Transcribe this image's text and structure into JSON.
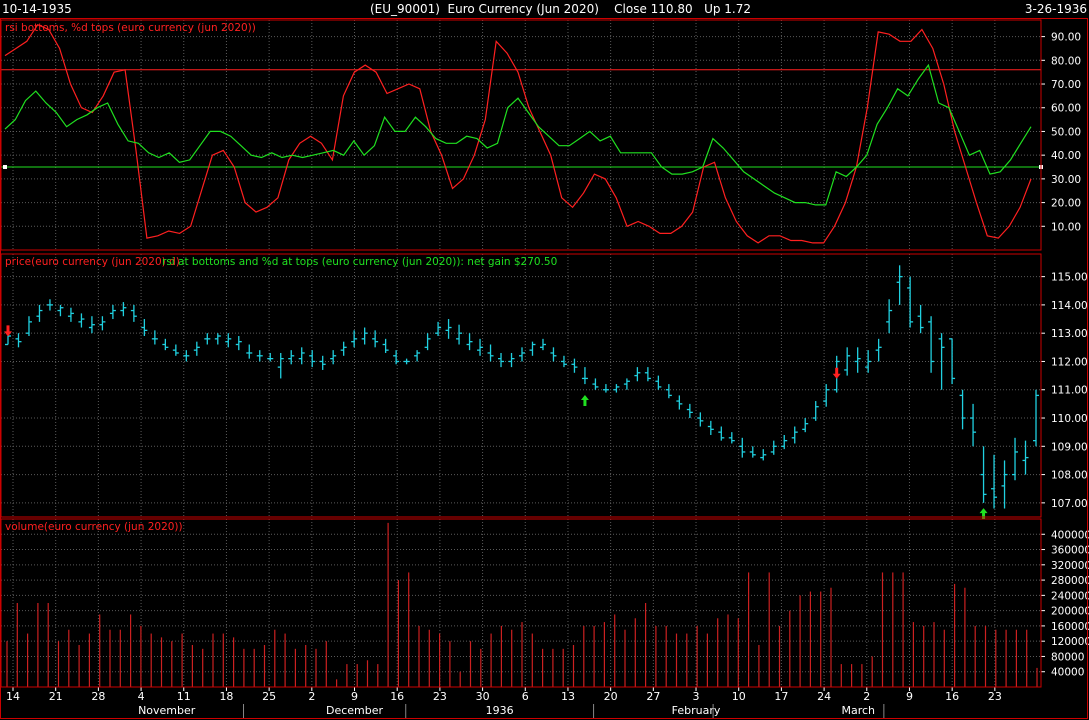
{
  "header": {
    "start_date": "10-14-1935",
    "title": "(EU_90001)  Euro Currency (Jun 2020)    Close 110.80   Up 1.72",
    "end_date": "3-26-1936"
  },
  "colors": {
    "background": "#000000",
    "frame": "#cc0000",
    "grid": "#5a5a5a",
    "rsi": "#ff2020",
    "stoch_d": "#20e020",
    "price_bar": "#20d0e0",
    "volume_bar": "#cc2020",
    "axis_text": "#ffffff",
    "buy_arrow": "#20e020",
    "sell_arrow": "#ff2020",
    "panel_label_rsi": "#ff2020",
    "panel_label_price": "#ff2020",
    "panel_label_price_2": "#20e020",
    "panel_label_volume": "#ff2020"
  },
  "chart_data": [
    {
      "type": "line",
      "title": "rsi bottoms, %d tops (euro currency (jun 2020))",
      "ylim": [
        0,
        97
      ],
      "yticks": [
        10,
        20,
        30,
        40,
        50,
        60,
        70,
        80,
        90
      ],
      "ytick_labels": [
        "10.00",
        "20.00",
        "30.00",
        "40.00",
        "50.00",
        "60.00",
        "70.00",
        "80.00",
        "90.00"
      ],
      "reference_lines": [
        35,
        76
      ],
      "series": [
        {
          "color": "rsi",
          "values": [
            82,
            85,
            88,
            95,
            93,
            85,
            70,
            60,
            58,
            65,
            75,
            76,
            42,
            5,
            6,
            8,
            7,
            10,
            25,
            40,
            42,
            35,
            20,
            16,
            18,
            22,
            38,
            45,
            48,
            45,
            38,
            65,
            75,
            78,
            75,
            66,
            68,
            70,
            68,
            50,
            40,
            26,
            30,
            40,
            55,
            88,
            83,
            75,
            60,
            50,
            40,
            22,
            18,
            24,
            32,
            30,
            22,
            10,
            12,
            10,
            7,
            7,
            10,
            16,
            35,
            37,
            22,
            12,
            6,
            3,
            6,
            6,
            4,
            4,
            3,
            3,
            10,
            20,
            35,
            60,
            92,
            91,
            88,
            88,
            93,
            85,
            70,
            50,
            35,
            20,
            6,
            5,
            10,
            18,
            30
          ]
        },
        {
          "color": "stoch_d",
          "values": [
            51,
            55,
            63,
            67,
            62,
            58,
            52,
            55,
            57,
            60,
            62,
            53,
            46,
            45,
            41,
            39,
            41,
            37,
            38,
            44,
            50,
            50,
            48,
            44,
            40,
            39,
            41,
            39,
            40,
            39,
            40,
            41,
            42,
            40,
            46,
            40,
            44,
            56,
            50,
            50,
            56,
            52,
            47,
            45,
            45,
            48,
            47,
            43,
            45,
            60,
            64,
            58,
            52,
            48,
            44,
            44,
            47,
            50,
            46,
            48,
            41,
            41,
            41,
            41,
            35,
            32,
            32,
            33,
            35,
            47,
            43,
            38,
            33,
            30,
            27,
            24,
            22,
            20,
            20,
            19,
            19,
            33,
            31,
            35,
            40,
            53,
            60,
            68,
            65,
            72,
            78,
            62,
            60,
            50,
            40,
            42,
            32,
            33,
            38,
            45,
            52
          ]
        }
      ]
    },
    {
      "type": "bar",
      "subtype": "ohlc",
      "title": "price(euro currency (jun 2020) d)",
      "subtitle": "rsi at bottoms and %d at tops (euro currency (jun 2020)): net gain $270.50",
      "ylim": [
        106.5,
        115.8
      ],
      "yticks": [
        107,
        108,
        109,
        110,
        111,
        112,
        113,
        114,
        115
      ],
      "ytick_labels": [
        "107.00",
        "108.00",
        "109.00",
        "110.00",
        "111.00",
        "112.00",
        "113.00",
        "114.00",
        "115.00"
      ],
      "bars": [
        [
          12.6,
          13.2,
          12.6,
          12.9
        ],
        [
          12.8,
          13.0,
          12.5,
          12.7
        ],
        [
          13.0,
          13.6,
          12.9,
          13.4
        ],
        [
          13.6,
          14.0,
          13.4,
          13.8
        ],
        [
          14.0,
          14.2,
          13.8,
          14.0
        ],
        [
          13.8,
          14.0,
          13.6,
          13.9
        ],
        [
          13.6,
          13.9,
          13.4,
          13.7
        ],
        [
          13.4,
          13.7,
          13.2,
          13.5
        ],
        [
          13.2,
          13.6,
          13.0,
          13.3
        ],
        [
          13.3,
          13.6,
          13.1,
          13.4
        ],
        [
          13.7,
          14.0,
          13.5,
          13.8
        ],
        [
          13.8,
          14.1,
          13.6,
          13.9
        ],
        [
          13.8,
          14.0,
          13.4,
          13.6
        ],
        [
          13.2,
          13.5,
          12.9,
          13.1
        ],
        [
          12.8,
          13.1,
          12.6,
          12.8
        ],
        [
          12.6,
          12.8,
          12.4,
          12.5
        ],
        [
          12.4,
          12.6,
          12.2,
          12.3
        ],
        [
          12.2,
          12.4,
          12.0,
          12.2
        ],
        [
          12.4,
          12.7,
          12.2,
          12.5
        ],
        [
          12.8,
          13.0,
          12.6,
          12.8
        ],
        [
          12.8,
          13.0,
          12.6,
          12.9
        ],
        [
          12.7,
          13.0,
          12.5,
          12.8
        ],
        [
          12.6,
          12.9,
          12.4,
          12.7
        ],
        [
          12.3,
          12.6,
          12.1,
          12.3
        ],
        [
          12.2,
          12.4,
          12.0,
          12.2
        ],
        [
          12.1,
          12.3,
          12.0,
          12.1
        ],
        [
          11.8,
          12.3,
          11.4,
          12.1
        ],
        [
          12.1,
          12.4,
          11.9,
          12.2
        ],
        [
          12.1,
          12.5,
          11.9,
          12.3
        ],
        [
          12.2,
          12.4,
          11.8,
          12.0
        ],
        [
          12.0,
          12.2,
          11.7,
          11.9
        ],
        [
          12.1,
          12.4,
          11.9,
          12.2
        ],
        [
          12.4,
          12.7,
          12.2,
          12.5
        ],
        [
          12.7,
          13.1,
          12.5,
          12.8
        ],
        [
          12.8,
          13.2,
          12.6,
          13.0
        ],
        [
          12.8,
          13.1,
          12.5,
          12.7
        ],
        [
          12.6,
          12.8,
          12.3,
          12.4
        ],
        [
          12.2,
          12.4,
          11.9,
          12.0
        ],
        [
          12.0,
          12.1,
          11.9,
          12.0
        ],
        [
          12.2,
          12.4,
          12.0,
          12.3
        ],
        [
          12.5,
          13.0,
          12.4,
          12.8
        ],
        [
          13.0,
          13.4,
          12.9,
          13.2
        ],
        [
          13.1,
          13.5,
          12.8,
          13.2
        ],
        [
          12.8,
          13.3,
          12.6,
          13.0
        ],
        [
          12.6,
          13.0,
          12.4,
          12.7
        ],
        [
          12.4,
          12.8,
          12.2,
          12.5
        ],
        [
          12.3,
          12.6,
          12.0,
          12.2
        ],
        [
          12.1,
          12.3,
          11.8,
          12.0
        ],
        [
          12.0,
          12.3,
          11.8,
          12.1
        ],
        [
          12.2,
          12.5,
          12.0,
          12.3
        ],
        [
          12.4,
          12.7,
          12.2,
          12.6
        ],
        [
          12.5,
          12.8,
          12.4,
          12.6
        ],
        [
          12.3,
          12.5,
          12.0,
          12.2
        ],
        [
          12.0,
          12.2,
          11.8,
          11.9
        ],
        [
          11.9,
          12.1,
          11.6,
          11.8
        ],
        [
          11.4,
          11.8,
          11.2,
          11.4
        ],
        [
          11.2,
          11.4,
          11.0,
          11.1
        ],
        [
          11.0,
          11.2,
          10.9,
          11.0
        ],
        [
          11.0,
          11.2,
          10.9,
          11.1
        ],
        [
          11.2,
          11.4,
          11.0,
          11.3
        ],
        [
          11.5,
          11.8,
          11.3,
          11.6
        ],
        [
          11.6,
          11.8,
          11.3,
          11.4
        ],
        [
          11.3,
          11.5,
          11.0,
          11.1
        ],
        [
          11.0,
          11.2,
          10.7,
          10.8
        ],
        [
          10.6,
          10.8,
          10.3,
          10.5
        ],
        [
          10.3,
          10.5,
          10.0,
          10.2
        ],
        [
          10.0,
          10.2,
          9.7,
          9.9
        ],
        [
          9.7,
          9.9,
          9.4,
          9.6
        ],
        [
          9.5,
          9.7,
          9.2,
          9.3
        ],
        [
          9.3,
          9.5,
          9.1,
          9.2
        ],
        [
          9.0,
          9.3,
          8.6,
          8.8
        ],
        [
          8.8,
          9.0,
          8.6,
          8.7
        ],
        [
          8.6,
          8.9,
          8.5,
          8.7
        ],
        [
          8.8,
          9.2,
          8.7,
          9.0
        ],
        [
          9.0,
          9.4,
          8.9,
          9.2
        ],
        [
          9.3,
          9.7,
          9.1,
          9.5
        ],
        [
          9.6,
          10.0,
          9.5,
          9.8
        ],
        [
          10.0,
          10.6,
          9.9,
          10.4
        ],
        [
          10.6,
          11.2,
          10.4,
          11.0
        ],
        [
          11.0,
          12.2,
          10.9,
          12.0
        ],
        [
          11.7,
          12.5,
          11.5,
          12.2
        ],
        [
          12.0,
          12.5,
          11.6,
          12.1
        ],
        [
          11.8,
          12.4,
          11.6,
          12.0
        ],
        [
          12.4,
          12.8,
          12.0,
          12.5
        ],
        [
          13.4,
          14.2,
          13.0,
          13.8
        ],
        [
          14.8,
          15.4,
          14.0,
          15.0
        ],
        [
          14.6,
          15.0,
          13.2,
          13.4
        ],
        [
          13.6,
          14.0,
          13.0,
          13.2
        ],
        [
          13.4,
          13.6,
          11.6,
          12.0
        ],
        [
          12.8,
          13.0,
          11.0,
          12.5
        ],
        [
          12.8,
          12.8,
          11.2,
          11.4
        ],
        [
          10.8,
          11.0,
          9.6,
          10.0
        ],
        [
          10.0,
          10.5,
          9.0,
          9.5
        ],
        [
          8.0,
          9.0,
          7.0,
          7.3
        ],
        [
          7.5,
          8.7,
          6.8,
          7.2
        ],
        [
          7.6,
          8.5,
          6.8,
          8.0
        ],
        [
          8.0,
          9.3,
          7.8,
          8.8
        ],
        [
          8.5,
          9.2,
          8.0,
          8.6
        ],
        [
          9.2,
          11.0,
          9.0,
          10.8
        ]
      ],
      "signals": [
        {
          "bar": 0,
          "type": "sell",
          "value": 113.1
        },
        {
          "bar": 55,
          "type": "buy",
          "value": 110.6
        },
        {
          "bar": 79,
          "type": "sell",
          "value": 111.6
        },
        {
          "bar": 93,
          "type": "buy",
          "value": 106.6
        }
      ]
    },
    {
      "type": "bar",
      "title": "volume(euro currency (jun 2020))",
      "ylim": [
        0,
        440000
      ],
      "yticks": [
        40000,
        80000,
        120000,
        160000,
        200000,
        240000,
        280000,
        320000,
        360000,
        400000
      ],
      "ytick_labels": [
        "40000",
        "80000",
        "120000",
        "160000",
        "200000",
        "240000",
        "280000",
        "320000",
        "360000",
        "400000"
      ],
      "values": [
        120000,
        220000,
        140000,
        220000,
        220000,
        120000,
        150000,
        110000,
        140000,
        190000,
        150000,
        150000,
        190000,
        160000,
        140000,
        130000,
        120000,
        140000,
        110000,
        100000,
        140000,
        140000,
        130000,
        100000,
        100000,
        110000,
        150000,
        140000,
        100000,
        110000,
        100000,
        120000,
        20000,
        60000,
        60000,
        70000,
        60000,
        430000,
        280000,
        300000,
        160000,
        150000,
        140000,
        120000,
        40000,
        120000,
        100000,
        140000,
        160000,
        150000,
        170000,
        140000,
        100000,
        100000,
        100000,
        110000,
        160000,
        160000,
        170000,
        190000,
        150000,
        180000,
        220000,
        160000,
        160000,
        140000,
        140000,
        160000,
        140000,
        180000,
        190000,
        180000,
        300000,
        110000,
        300000,
        160000,
        200000,
        240000,
        250000,
        250000,
        260000,
        60000,
        60000,
        60000,
        80000,
        300000,
        300000,
        300000,
        170000,
        160000,
        170000,
        150000,
        270000,
        260000,
        160000,
        160000,
        150000,
        150000,
        150000,
        150000,
        50000
      ]
    }
  ],
  "x_axis": {
    "day_labels": [
      "14",
      "21",
      "28",
      "4",
      "11",
      "18",
      "25",
      "2",
      "9",
      "16",
      "23",
      "30",
      "6",
      "13",
      "20",
      "27",
      "3",
      "10",
      "17",
      "24",
      "2",
      "9",
      "16",
      "23"
    ],
    "day_label_bars": [
      0,
      5,
      10,
      15,
      20,
      25,
      30,
      35,
      40,
      45,
      50,
      55,
      60,
      65,
      70,
      75,
      80,
      85,
      90,
      95,
      100,
      105,
      110,
      115
    ],
    "month_labels": [
      "November",
      "December",
      "1936",
      "February",
      "March"
    ],
    "month_label_bars": [
      18,
      40,
      57,
      80,
      99
    ]
  }
}
